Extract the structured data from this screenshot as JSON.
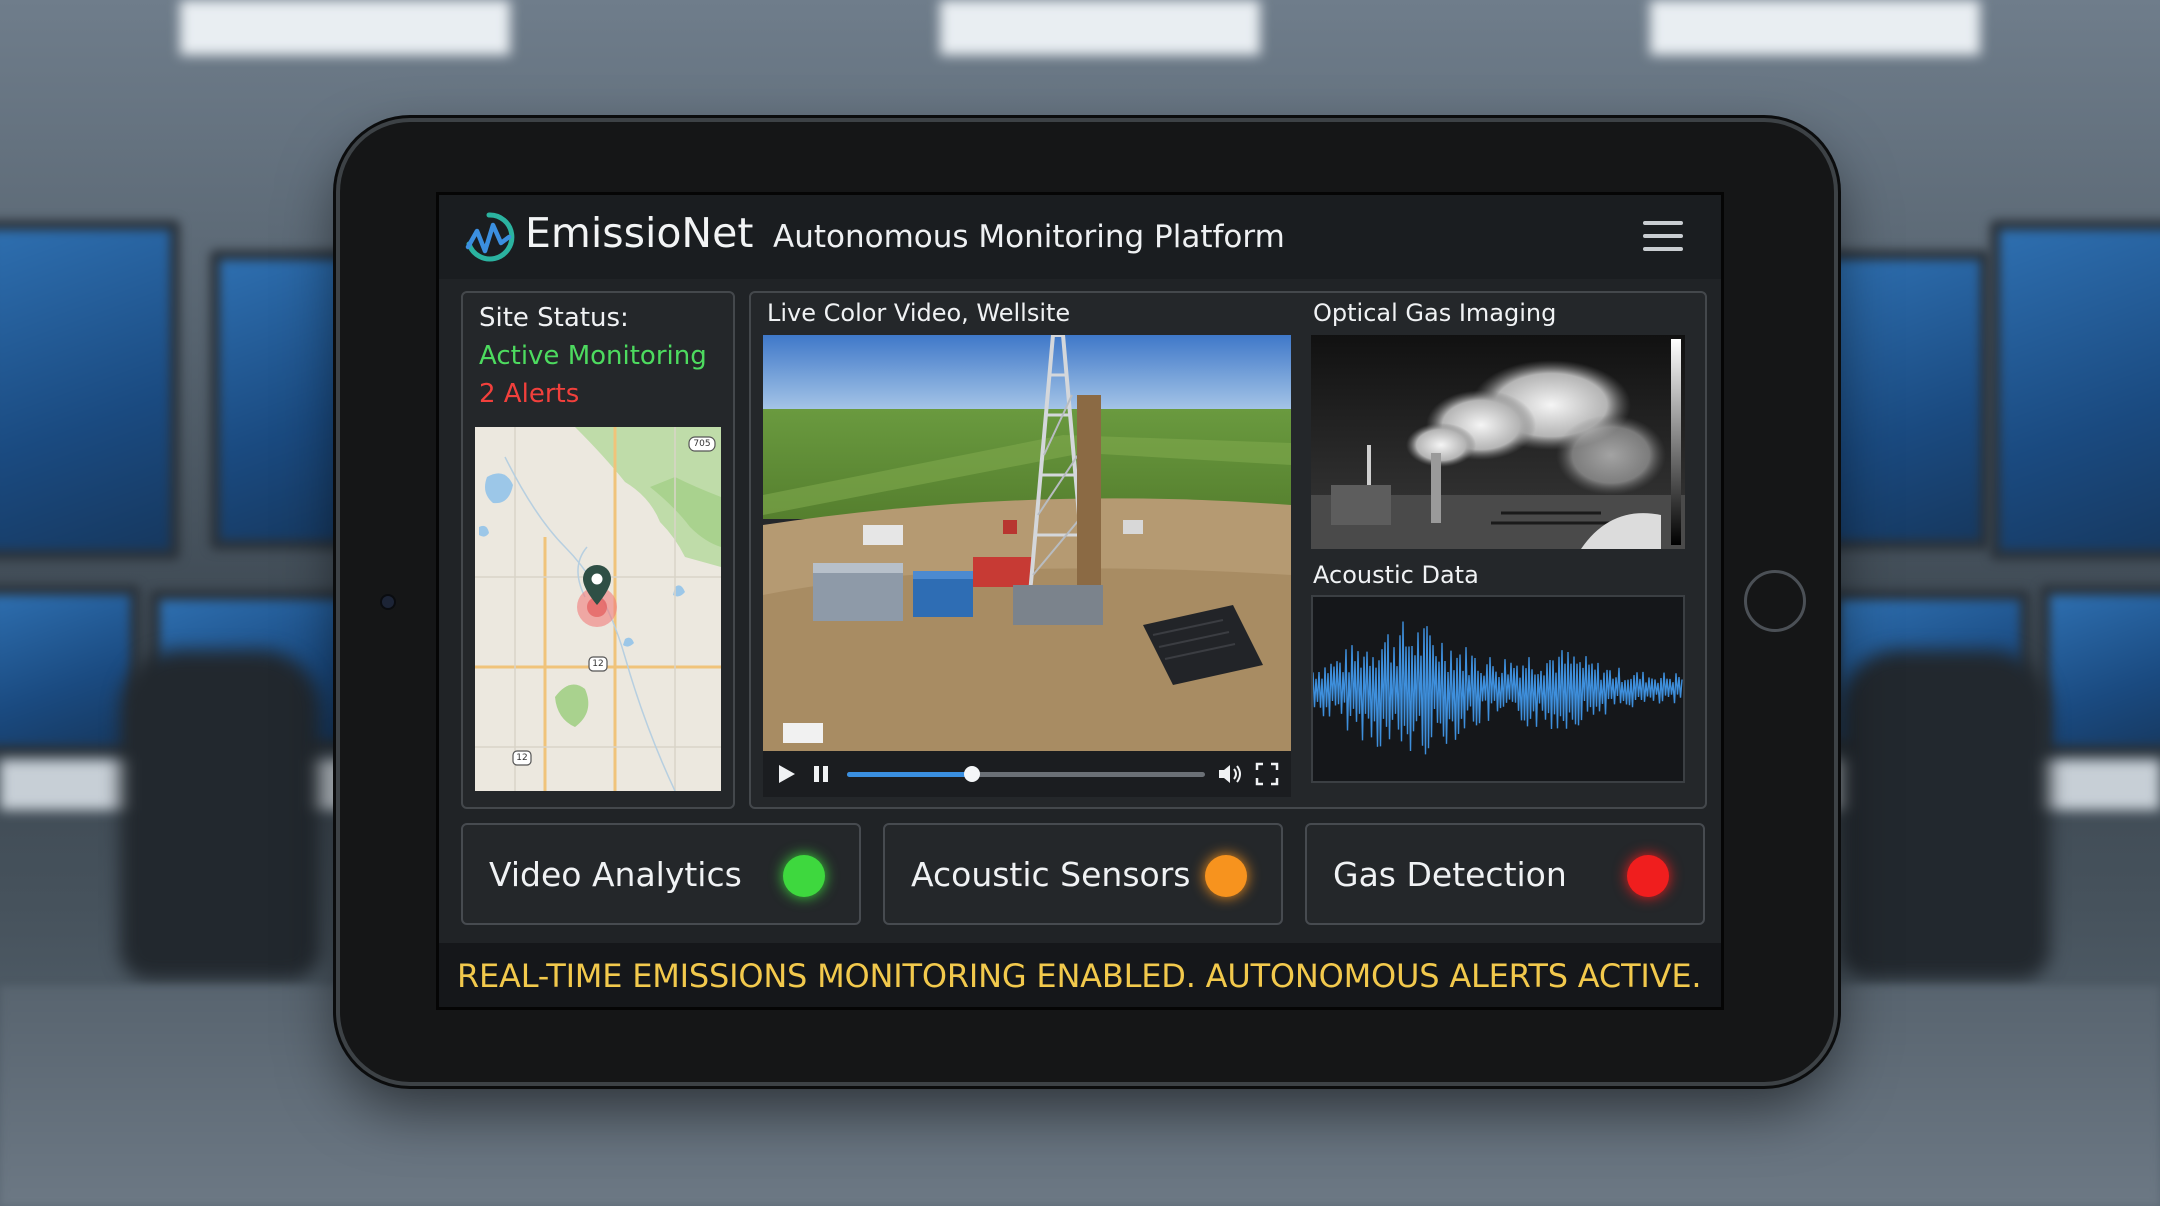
{
  "app": {
    "name": "EmissioNet",
    "subtitle": "Autonomous Monitoring Platform",
    "logo_icon": "waveform-logo-icon",
    "menu_icon": "hamburger-menu-icon"
  },
  "site_status": {
    "label": "Site Status:",
    "state": "Active Monitoring",
    "alerts": "2 Alerts",
    "state_color": "#4ddb5f",
    "alerts_color": "#f2403c",
    "map": {
      "road_labels": [
        "705",
        "12",
        "12"
      ],
      "marker_icon": "location-pin-icon"
    }
  },
  "video": {
    "title": "Live Color Video, Wellsite",
    "progress": 0.35,
    "controls": [
      "play-icon",
      "pause-icon",
      "volume-icon",
      "fullscreen-icon"
    ]
  },
  "ogi": {
    "title": "Optical Gas Imaging"
  },
  "acoustic": {
    "title": "Acoustic Data"
  },
  "indicators": [
    {
      "label": "Video Analytics",
      "color": "#3ed83e"
    },
    {
      "label": "Acoustic Sensors",
      "color": "#f7931e"
    },
    {
      "label": "Gas Detection",
      "color": "#f01e1e"
    }
  ],
  "ticker": {
    "text": "REAL-TIME EMISSIONS MONITORING ENABLED. AUTONOMOUS ALERTS ACTIVE."
  }
}
